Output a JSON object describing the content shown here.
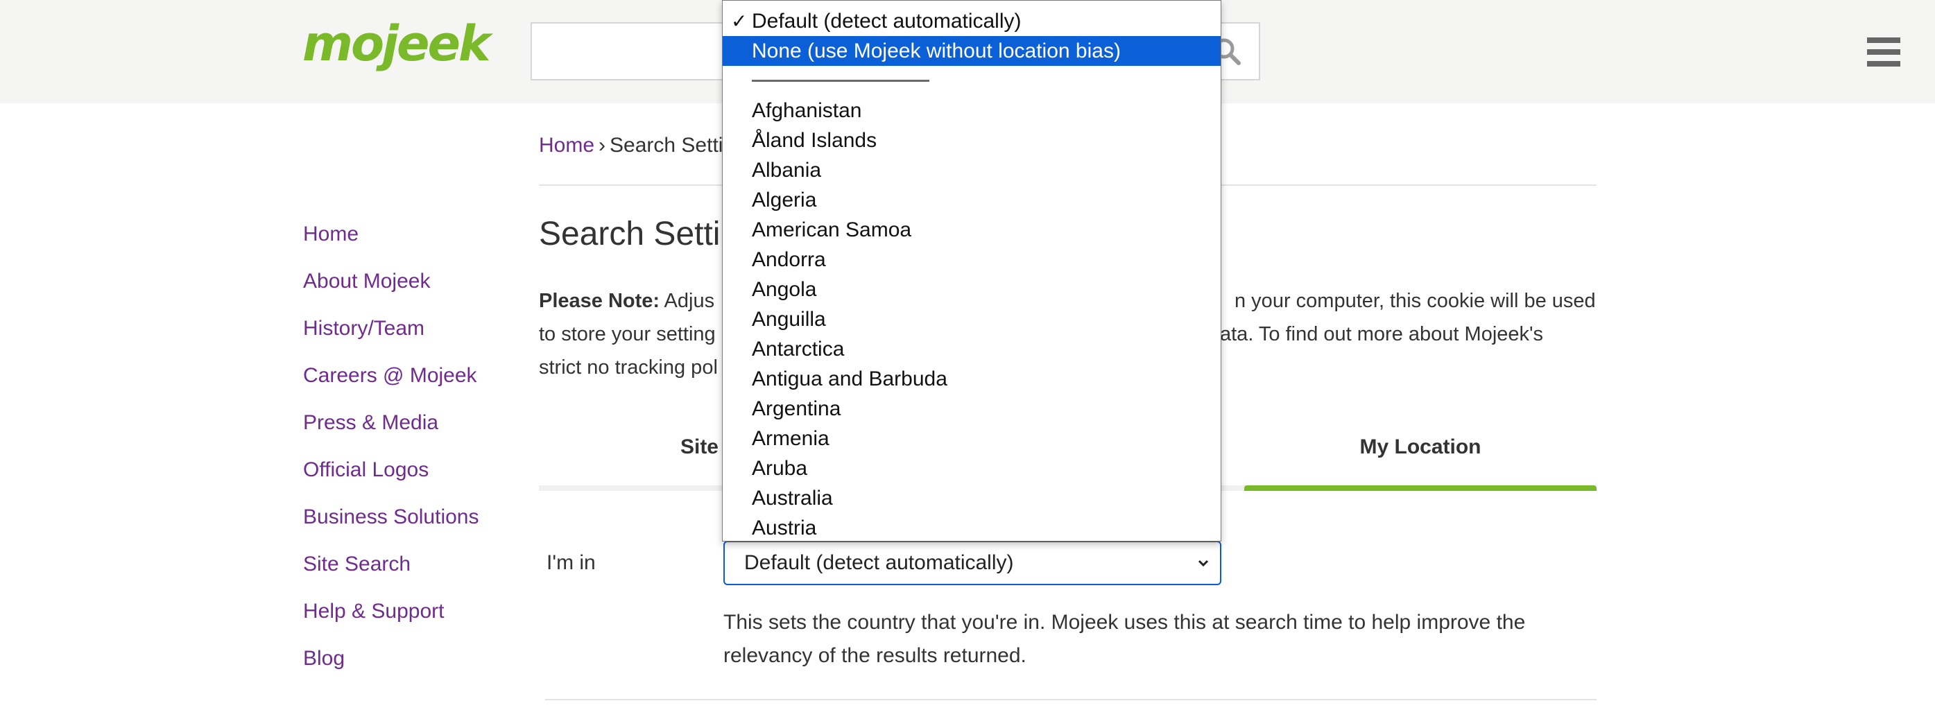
{
  "header": {
    "logo_text": "mojeek",
    "search": {
      "value": "",
      "placeholder": ""
    },
    "icons": {
      "search": "search-icon",
      "menu": "hamburger-menu-icon"
    }
  },
  "breadcrumb": {
    "home": "Home",
    "separator": "›",
    "current": "Search Setti"
  },
  "sidebar": {
    "items": [
      {
        "label": "Home"
      },
      {
        "label": "About Mojeek"
      },
      {
        "label": "History/Team"
      },
      {
        "label": "Careers @ Mojeek"
      },
      {
        "label": "Press & Media"
      },
      {
        "label": "Official Logos"
      },
      {
        "label": "Business Solutions"
      },
      {
        "label": "Site Search"
      },
      {
        "label": "Help & Support"
      },
      {
        "label": "Blog"
      }
    ]
  },
  "main": {
    "title": "Search Settin",
    "note": {
      "bold": "Please Note:",
      "line1_left": " Adjus",
      "line1_right": "n your computer, this cookie will be used",
      "line2_left": "to store your setting",
      "line2_right": "ata. To find out more about Mojeek's",
      "line3_left": "strict no tracking pol"
    },
    "tabs": [
      {
        "label": "Site Se"
      },
      {
        "label": "My Location",
        "active": true
      }
    ],
    "location_label": "I'm in",
    "select_value": "Default (detect automatically)",
    "help_text": "This sets the country that you're in. Mojeek uses this at search time to help improve the relevancy of the results returned."
  },
  "dropdown": {
    "checkmark": "✓",
    "options": [
      {
        "label": "Default (detect automatically)",
        "checked": true
      },
      {
        "label": "None (use Mojeek without location bias)",
        "highlighted": true
      },
      {
        "label": "Afghanistan"
      },
      {
        "label": "Åland Islands"
      },
      {
        "label": "Albania"
      },
      {
        "label": "Algeria"
      },
      {
        "label": "American Samoa"
      },
      {
        "label": "Andorra"
      },
      {
        "label": "Angola"
      },
      {
        "label": "Anguilla"
      },
      {
        "label": "Antarctica"
      },
      {
        "label": "Antigua and Barbuda"
      },
      {
        "label": "Argentina"
      },
      {
        "label": "Armenia"
      },
      {
        "label": "Aruba"
      },
      {
        "label": "Australia"
      },
      {
        "label": "Austria"
      }
    ]
  },
  "colors": {
    "brand_green": "#7ab929",
    "link_purple": "#6f2b8d",
    "highlight_blue": "#0b60d8",
    "topbar_bg": "#f5f5f3"
  }
}
